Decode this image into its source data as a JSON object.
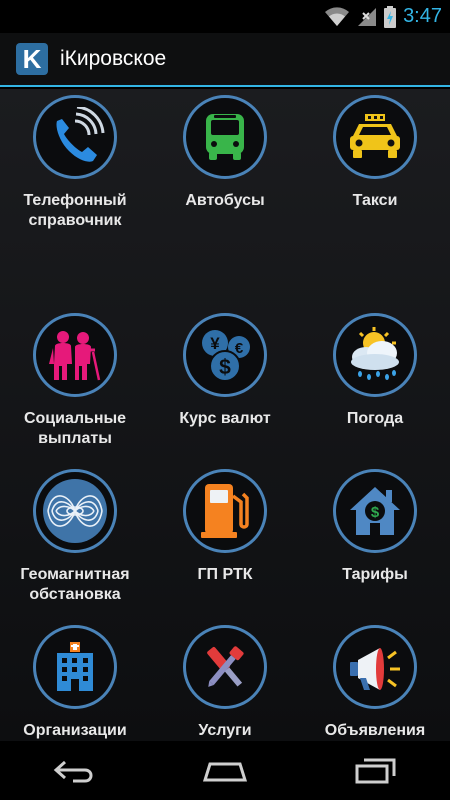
{
  "status_bar": {
    "time": "3:47"
  },
  "app": {
    "logo_letter": "K",
    "title": "iКировское"
  },
  "tiles": [
    {
      "label": "Телефонный\nсправочник",
      "icon": "phone-icon"
    },
    {
      "label": "Автобусы",
      "icon": "bus-icon"
    },
    {
      "label": "Такси",
      "icon": "taxi-icon"
    },
    {
      "label": "Социальные\nвыплаты",
      "icon": "elderly-people-icon"
    },
    {
      "label": "Курс валют",
      "icon": "currency-icon"
    },
    {
      "label": "Погода",
      "icon": "weather-icon"
    },
    {
      "label": "Геомагнитная\nобстановка",
      "icon": "magnetic-field-icon"
    },
    {
      "label": "ГП РТК",
      "icon": "fuel-pump-icon"
    },
    {
      "label": "Тарифы",
      "icon": "house-dollar-icon"
    },
    {
      "label": "Организации\nгорода",
      "icon": "building-icon"
    },
    {
      "label": "Услуги",
      "icon": "tools-icon"
    },
    {
      "label": "Объявления",
      "icon": "megaphone-icon"
    }
  ],
  "colors": {
    "accent": "#33b5e5",
    "circle_border": "#4a83b8"
  }
}
